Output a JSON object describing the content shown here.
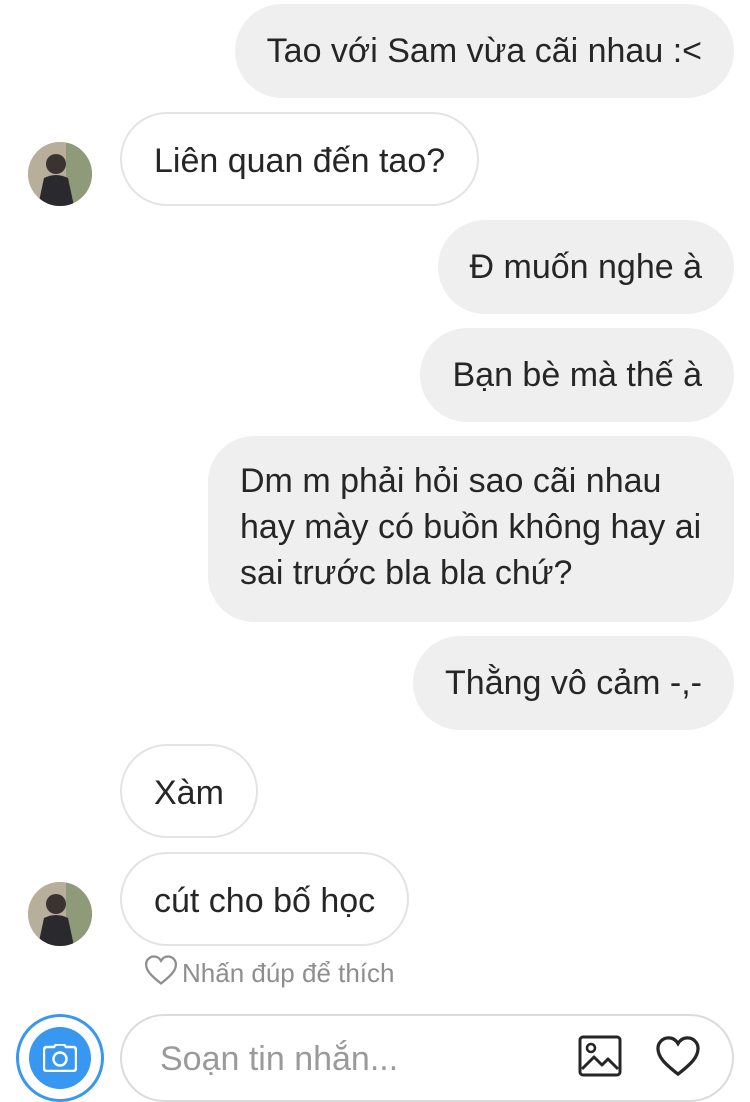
{
  "messages": [
    {
      "direction": "out",
      "text": "Tao với Sam vừa cãi nhau :<"
    },
    {
      "direction": "in",
      "text": "Liên quan đến tao?"
    },
    {
      "direction": "out",
      "text": "Đ muốn nghe à"
    },
    {
      "direction": "out",
      "text": "Bạn bè mà thế à"
    },
    {
      "direction": "out",
      "text": "Dm m phải hỏi sao cãi nhau hay mày có buồn không hay ai sai trước bla bla chứ?"
    },
    {
      "direction": "out",
      "text": "Thằng vô cảm -,-"
    },
    {
      "direction": "in",
      "text": "Xàm"
    },
    {
      "direction": "in",
      "text": "cút cho bố học"
    }
  ],
  "like_hint": "Nhấn đúp để thích",
  "composer": {
    "placeholder": "Soạn tin nhắn...",
    "camera_icon": "camera-icon",
    "gallery_icon": "image-icon",
    "like_icon": "heart-icon"
  },
  "colors": {
    "accent": "#3897f0",
    "outgoing_bubble": "#efefef",
    "incoming_border": "#e3e3e3",
    "hint_text": "#8e8e8e"
  }
}
